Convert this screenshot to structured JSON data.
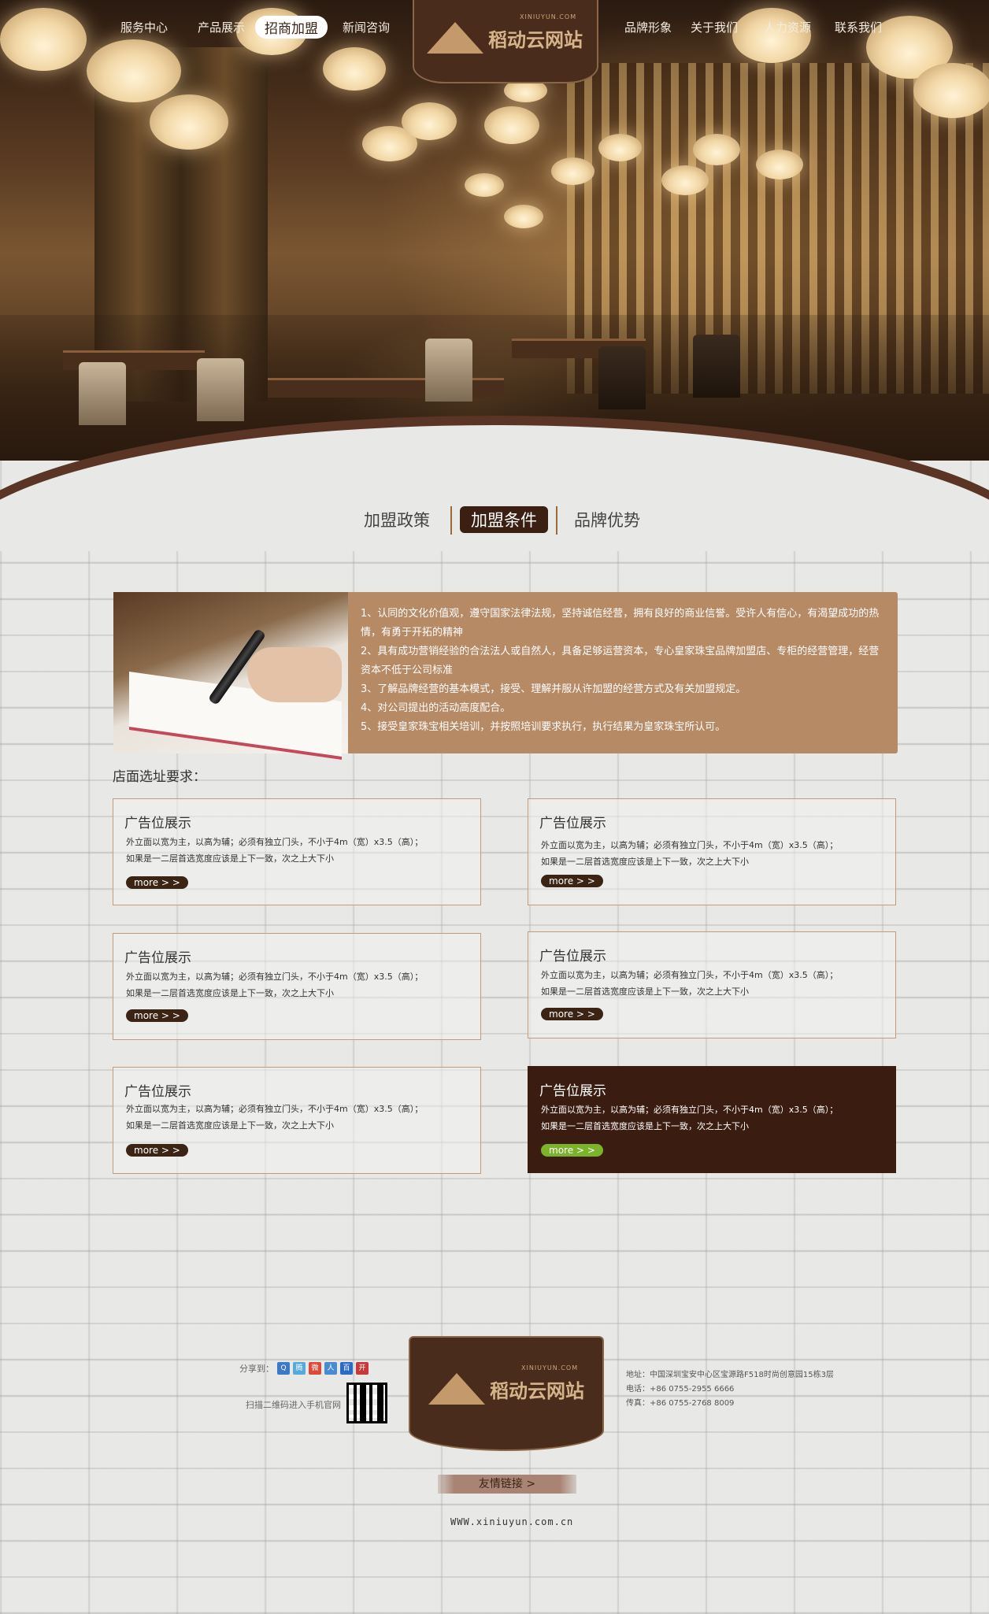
{
  "nav": {
    "left": [
      "服务中心",
      "产品展示",
      "招商加盟",
      "新闻咨询"
    ],
    "right": [
      "品牌形象",
      "关于我们",
      "人力资源",
      "联系我们"
    ],
    "active": "招商加盟"
  },
  "logo": {
    "text": "稻动云网站",
    "sub": "XINIUYUN.COM"
  },
  "tabs": [
    "加盟政策",
    "加盟条件",
    "品牌优势"
  ],
  "active_tab": "加盟条件",
  "info": {
    "items": [
      "1、认同的文化价值观，遵守国家法律法规，坚持诚信经营，拥有良好的商业信誉。受许人有信心，有渴望成功的热情，有勇于开拓的精神",
      "2、具有成功营销经验的合法法人或自然人，具备足够运营资本，专心皇家珠宝品牌加盟店、专柜的经营管理，经营资本不低于公司标准",
      "3、了解品牌经营的基本模式，接受、理解并服从许加盟的经营方式及有关加盟规定。",
      "4、对公司提出的活动高度配合。",
      "5、接受皇家珠宝相关培训，并按照培训要求执行，执行结果为皇家珠宝所认可。"
    ]
  },
  "section_title": "店面选址要求：",
  "cards": [
    {
      "title": "广告位展示",
      "line1": "外立面以宽为主，以高为辅；必须有独立门头，不小于4m（宽）x3.5（高）；",
      "line2": "如果是一二层首选宽度应该是上下一致，次之上大下小",
      "more": "more > >"
    },
    {
      "title": "广告位展示",
      "line1": "外立面以宽为主，以高为辅；必须有独立门头，不小于4m（宽）x3.5（高）；",
      "line2": "如果是一二层首选宽度应该是上下一致，次之上大下小",
      "more": "more > >"
    },
    {
      "title": "广告位展示",
      "line1": "外立面以宽为主，以高为辅；必须有独立门头，不小于4m（宽）x3.5（高）；",
      "line2": "如果是一二层首选宽度应该是上下一致，次之上大下小",
      "more": "more > >"
    },
    {
      "title": "广告位展示",
      "line1": "外立面以宽为主，以高为辅；必须有独立门头，不小于4m（宽）x3.5（高）；",
      "line2": "如果是一二层首选宽度应该是上下一致，次之上大下小",
      "more": "more > >"
    },
    {
      "title": "广告位展示",
      "line1": "外立面以宽为主，以高为辅；必须有独立门头，不小于4m（宽）x3.5（高）；",
      "line2": "如果是一二层首选宽度应该是上下一致，次之上大下小",
      "more": "more > >"
    },
    {
      "title": "广告位展示",
      "line1": "外立面以宽为主，以高为辅；必须有独立门头，不小于4m（宽）x3.5（高）；",
      "line2": "如果是一二层首选宽度应该是上下一致，次之上大下小",
      "more": "more > >"
    }
  ],
  "footer": {
    "share_label": "分享到：",
    "share_icons": [
      "qzone-icon",
      "tencent-weibo-icon",
      "sina-weibo-icon",
      "renren-icon",
      "baidu-icon",
      "kaixin-icon"
    ],
    "share_colors": [
      "#3a7ac8",
      "#58a8d8",
      "#d84a3a",
      "#4a8ad0",
      "#2a6ac8",
      "#c83a3a"
    ],
    "scan_text": "扫描二维码进入手机官网",
    "address": "地址：中国深圳宝安中心区宝源路F518时尚创意园15栋3层",
    "phone": "电话：+86 0755-2955 6666",
    "fax": "传真：+86 0755-2768 8009",
    "friend_links": "友情链接 >",
    "url": "WWW.xiniuyun.com.cn"
  }
}
